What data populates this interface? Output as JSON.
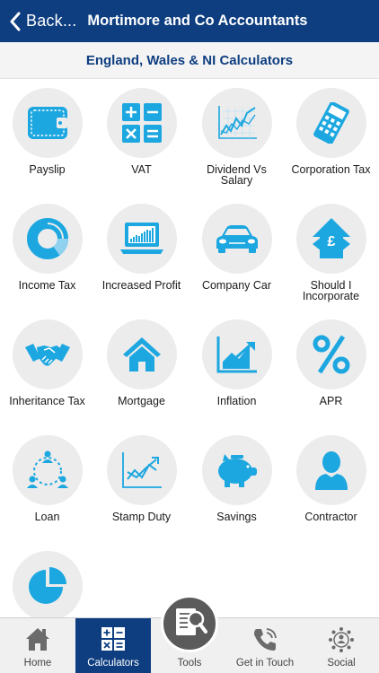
{
  "navbar": {
    "back_label": "Back...",
    "title": "Mortimore and Co Accountants"
  },
  "subheader": {
    "title": "England, Wales & NI Calculators"
  },
  "calculators": [
    {
      "label": "Payslip",
      "icon": "wallet-icon"
    },
    {
      "label": "VAT",
      "icon": "calculator-keys-icon"
    },
    {
      "label": "Dividend Vs Salary",
      "icon": "line-graph-icon"
    },
    {
      "label": "Corporation Tax",
      "icon": "calculator-icon"
    },
    {
      "label": "Income Tax",
      "icon": "donut-chart-icon"
    },
    {
      "label": "Increased Profit",
      "icon": "laptop-chart-icon"
    },
    {
      "label": "Company Car",
      "icon": "car-icon"
    },
    {
      "label": "Should I Incorporate",
      "icon": "house-pound-icon"
    },
    {
      "label": "Inheritance Tax",
      "icon": "handshake-icon"
    },
    {
      "label": "Mortgage",
      "icon": "house-icon"
    },
    {
      "label": "Inflation",
      "icon": "rising-chart-icon"
    },
    {
      "label": "APR",
      "icon": "percent-icon"
    },
    {
      "label": "Loan",
      "icon": "people-network-icon"
    },
    {
      "label": "Stamp Duty",
      "icon": "trend-chart-icon"
    },
    {
      "label": "Savings",
      "icon": "piggy-bank-icon"
    },
    {
      "label": "Contractor",
      "icon": "person-icon"
    },
    {
      "label": "",
      "icon": "pie-chart-icon"
    }
  ],
  "tabs": [
    {
      "label": "Home",
      "icon": "home-icon"
    },
    {
      "label": "Calculators",
      "icon": "calculator-tab-icon",
      "active": true
    },
    {
      "label": "Tools",
      "icon": "document-search-icon"
    },
    {
      "label": "Get in Touch",
      "icon": "phone-icon"
    },
    {
      "label": "Social",
      "icon": "social-network-icon"
    }
  ],
  "colors": {
    "accent": "#1da7e0",
    "navbar": "#0e3e80",
    "circle_bg": "#ececec"
  }
}
